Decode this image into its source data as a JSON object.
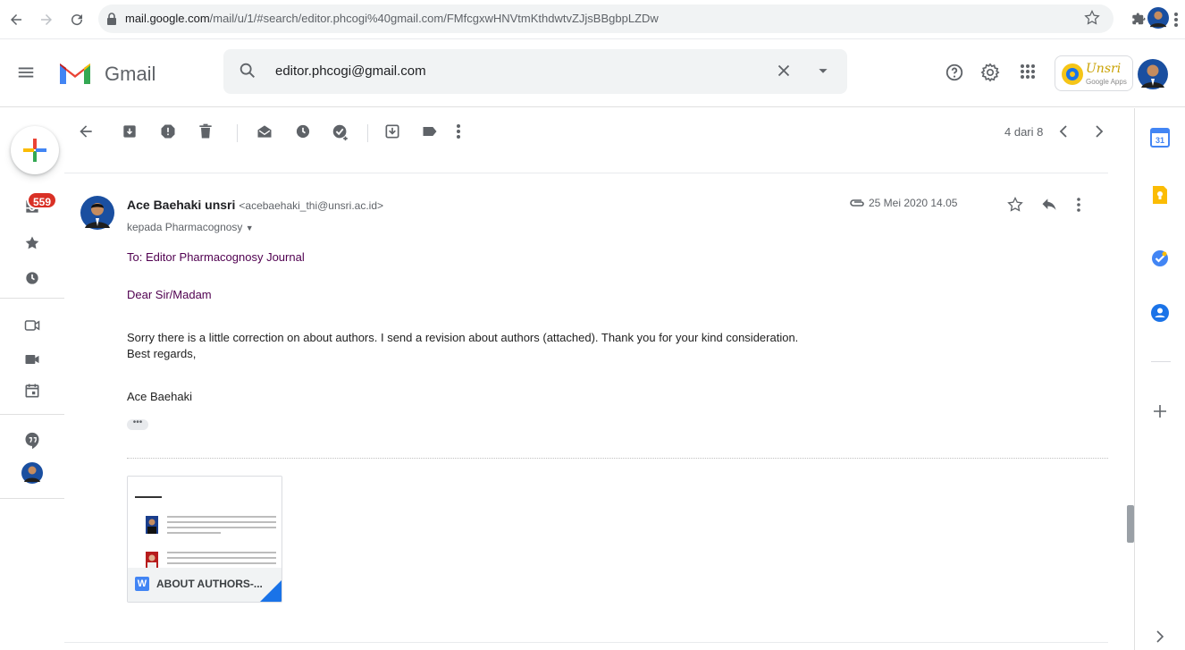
{
  "browser": {
    "url_host": "mail.google.com",
    "url_path": "/mail/u/1/#search/editor.phcogi%40gmail.com/FMfcgxwHNVtmKthdwtvZJjsBBgbpLZDw"
  },
  "header": {
    "product_name": "Gmail",
    "search_query": "editor.phcogi@gmail.com",
    "org_logo_text": "Unsri",
    "org_logo_sub": "Google Apps"
  },
  "rail": {
    "inbox_count": "559"
  },
  "toolbar": {
    "page_count": "4 dari 8"
  },
  "message": {
    "sender_name": "Ace Baehaki unsri",
    "sender_email": "<acebaehaki_thi@unsri.ac.id>",
    "recipient": "kepada Pharmacognosy",
    "date": "25 Mei 2020 14.05",
    "body": {
      "to_line": "To: Editor Pharmacognosy Journal",
      "greeting": "Dear Sir/Madam",
      "text": "Sorry there is a little correction on about authors. I send a revision about authors (attached). Thank you for your kind consideration.",
      "closing": "Best regards,",
      "signature": "Ace Baehaki"
    },
    "show_trimmed": "•••"
  },
  "attachment": {
    "file_type": "W",
    "file_name": "ABOUT AUTHORS-..."
  },
  "colors": {
    "badge_red": "#d93025",
    "purple_text": "#500050",
    "accent_blue": "#1a73e8"
  }
}
